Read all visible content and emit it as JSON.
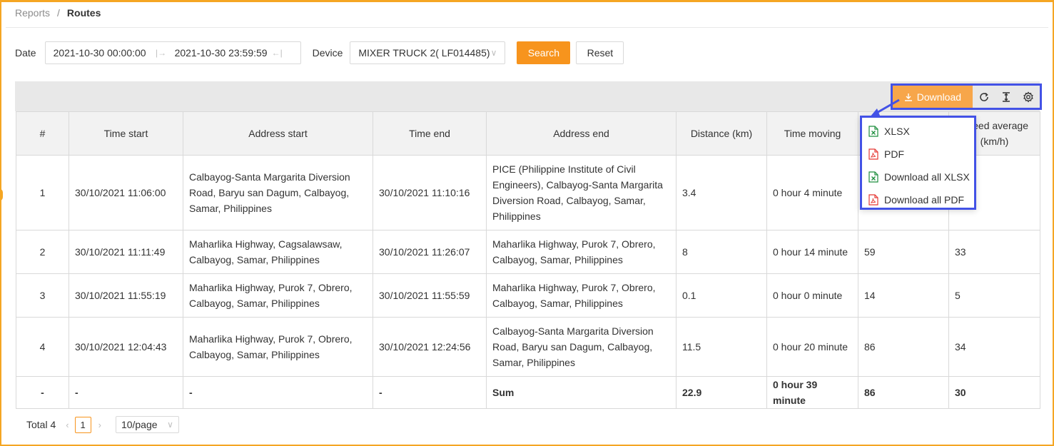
{
  "breadcrumb": {
    "root": "Reports",
    "separator": "/",
    "current": "Routes"
  },
  "filters": {
    "date_label": "Date",
    "date_start": "2021-10-30 00:00:00",
    "date_end": "2021-10-30 23:59:59",
    "device_label": "Device",
    "device_value": "MIXER TRUCK 2( LF014485)",
    "search_label": "Search",
    "reset_label": "Reset"
  },
  "toolbar": {
    "download_label": "Download",
    "icons": [
      "refresh-icon",
      "column-height-icon",
      "settings-icon"
    ]
  },
  "download_menu": {
    "items": [
      {
        "label": "XLSX",
        "icon": "xlsx-file-icon"
      },
      {
        "label": "PDF",
        "icon": "pdf-file-icon"
      },
      {
        "label": "Download all XLSX",
        "icon": "xlsx-file-icon"
      },
      {
        "label": "Download all PDF",
        "icon": "pdf-file-icon"
      }
    ]
  },
  "table": {
    "headers": [
      "#",
      "Time start",
      "Address start",
      "Time end",
      "Address end",
      "Distance (km)",
      "Time moving",
      "",
      "Speed average (km/h)"
    ],
    "rows": [
      {
        "idx": "1",
        "time_start": "30/10/2021 11:06:00",
        "address_start": "Calbayog-Santa Margarita Diversion Road, Baryu san Dagum, Calbayog, Samar, Philippines",
        "time_end": "30/10/2021 11:10:16",
        "address_end": "PICE (Philippine Institute of Civil Engineers), Calbayog-Santa Margarita Diversion Road, Calbayog, Samar, Philippines",
        "distance": "3.4",
        "time_moving": "0 hour 4 minute",
        "max_speed": "",
        "avg_speed": ""
      },
      {
        "idx": "2",
        "time_start": "30/10/2021 11:11:49",
        "address_start": "Maharlika Highway, Cagsalawsaw, Calbayog, Samar, Philippines",
        "time_end": "30/10/2021 11:26:07",
        "address_end": "Maharlika Highway, Purok 7, Obrero, Calbayog, Samar, Philippines",
        "distance": "8",
        "time_moving": "0 hour 14 minute",
        "max_speed": "59",
        "avg_speed": "33"
      },
      {
        "idx": "3",
        "time_start": "30/10/2021 11:55:19",
        "address_start": "Maharlika Highway, Purok 7, Obrero, Calbayog, Samar, Philippines",
        "time_end": "30/10/2021 11:55:59",
        "address_end": "Maharlika Highway, Purok 7, Obrero, Calbayog, Samar, Philippines",
        "distance": "0.1",
        "time_moving": "0 hour 0 minute",
        "max_speed": "14",
        "avg_speed": "5"
      },
      {
        "idx": "4",
        "time_start": "30/10/2021 12:04:43",
        "address_start": "Maharlika Highway, Purok 7, Obrero, Calbayog, Samar, Philippines",
        "time_end": "30/10/2021 12:24:56",
        "address_end": "Calbayog-Santa Margarita Diversion Road, Baryu san Dagum, Calbayog, Samar, Philippines",
        "distance": "11.5",
        "time_moving": "0 hour 20 minute",
        "max_speed": "86",
        "avg_speed": "34"
      }
    ],
    "summary": {
      "idx": "-",
      "time_start": "-",
      "address_start": "-",
      "time_end": "-",
      "address_end": "Sum",
      "distance": "22.9",
      "time_moving": "0 hour 39 minute",
      "max_speed": "86",
      "avg_speed": "30"
    }
  },
  "pagination": {
    "total_label": "Total 4",
    "current_page": "1",
    "page_size": "10/page"
  },
  "colors": {
    "accent": "#f7941d",
    "highlight": "#4352e6",
    "frame": "#f5a623"
  }
}
